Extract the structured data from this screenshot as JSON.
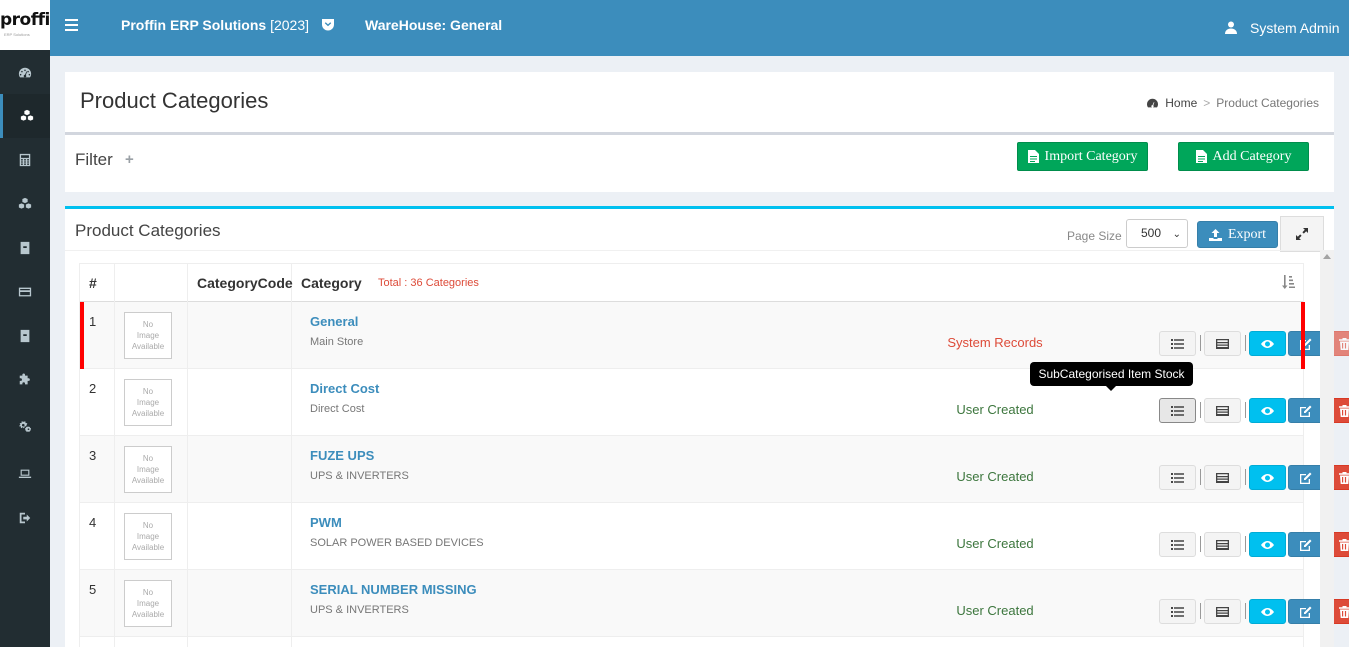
{
  "logo": {
    "text": "proffin",
    "sub": "ERP Solutions"
  },
  "header": {
    "brand": "Proffin ERP Solutions",
    "year": "[2023]",
    "warehouse": "WareHouse: General",
    "user": "System Admin"
  },
  "sidebar": {
    "icons": [
      "dashboard-icon",
      "cubes-icon",
      "calculator-icon",
      "cubes-icon",
      "archive-icon",
      "credit-card-icon",
      "archive-icon",
      "puzzle-icon",
      "cogs-icon",
      "laptop-icon",
      "sign-out-icon"
    ]
  },
  "page": {
    "title": "Product Categories",
    "breadcrumb": {
      "home": "Home",
      "current": "Product Categories"
    }
  },
  "filter": {
    "label": "Filter",
    "plus": "+",
    "import_label": "Import Category",
    "add_label": "Add Category"
  },
  "list": {
    "title": "Product Categories",
    "page_size_label": "Page Size",
    "page_size": "500",
    "export_label": "Export"
  },
  "table": {
    "headers": {
      "num": "#",
      "code": "CategoryCode",
      "category": "Category"
    },
    "total": "Total : 36 Categories",
    "no_image": [
      "No",
      "Image",
      "Available"
    ],
    "rows": [
      {
        "num": "1",
        "name": "General",
        "desc": "Main Store",
        "status": "System Records"
      },
      {
        "num": "2",
        "name": "Direct Cost",
        "desc": "Direct Cost",
        "status": "User Created"
      },
      {
        "num": "3",
        "name": "FUZE UPS",
        "desc": "UPS & INVERTERS",
        "status": "User Created"
      },
      {
        "num": "4",
        "name": "PWM",
        "desc": "SOLAR POWER BASED DEVICES",
        "status": "User Created"
      },
      {
        "num": "5",
        "name": "SERIAL NUMBER MISSING",
        "desc": "UPS & INVERTERS",
        "status": "User Created"
      }
    ]
  },
  "tooltip": "SubCategorised Item Stock",
  "colors": {
    "header": "#3c8dbc",
    "sidebar": "#222d32",
    "success": "#00a65a",
    "info": "#00c0ef",
    "danger": "#dd4b39",
    "system_marker": "#ff0000"
  }
}
